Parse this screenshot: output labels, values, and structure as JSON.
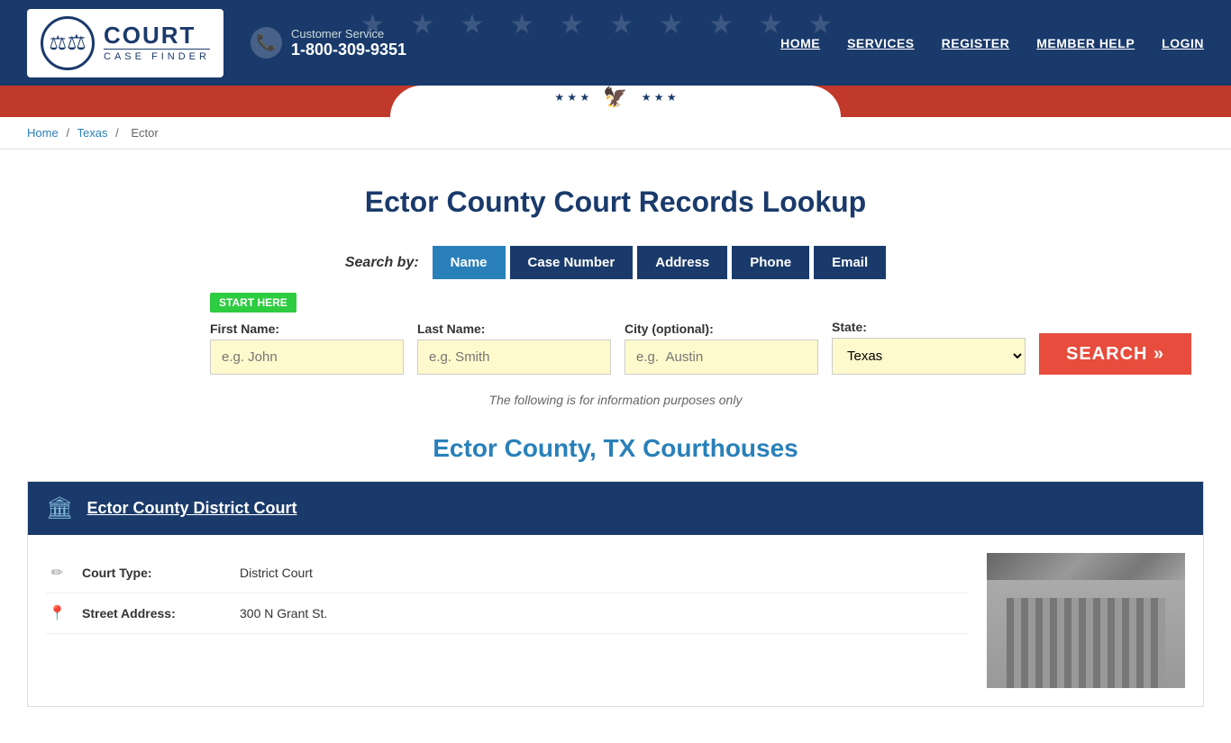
{
  "header": {
    "logo": {
      "court_text": "COURT",
      "case_finder_text": "CASE FINDER"
    },
    "customer_service": {
      "label": "Customer Service",
      "phone": "1-800-309-9351"
    },
    "nav": {
      "home": "HOME",
      "services": "SERVICES",
      "register": "REGISTER",
      "member_help": "MEMBER HELP",
      "login": "LOGIN"
    }
  },
  "breadcrumb": {
    "home": "Home",
    "state": "Texas",
    "county": "Ector"
  },
  "page_title": "Ector County Court Records Lookup",
  "search": {
    "search_by_label": "Search by:",
    "tabs": [
      "Name",
      "Case Number",
      "Address",
      "Phone",
      "Email"
    ],
    "active_tab": "Name",
    "start_here": "START HERE",
    "fields": {
      "first_name_label": "First Name:",
      "first_name_placeholder": "e.g. John",
      "last_name_label": "Last Name:",
      "last_name_placeholder": "e.g. Smith",
      "city_label": "City (optional):",
      "city_placeholder": "e.g.  Austin",
      "state_label": "State:",
      "state_value": "Texas"
    },
    "search_button": "SEARCH »",
    "info_text": "The following is for information purposes only"
  },
  "courthouses_title": "Ector County, TX Courthouses",
  "courthouses": [
    {
      "name": "Ector County District Court",
      "court_type": "District Court",
      "street_address": "300 N Grant St.",
      "city_state": "",
      "phone": ""
    }
  ],
  "labels": {
    "court_type": "Court Type:",
    "street_address": "Street Address:"
  }
}
